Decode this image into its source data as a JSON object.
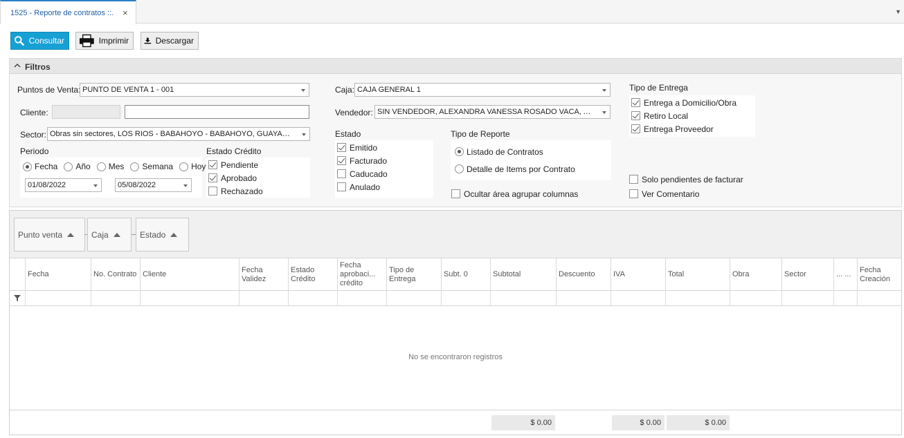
{
  "tab": {
    "title": "1525 - Reporte de contratos ::."
  },
  "toolbar": {
    "consultar": "Consultar",
    "imprimir": "Imprimir",
    "descargar": "Descargar"
  },
  "filtros": {
    "title": "Filtros",
    "puntos_venta_label": "Puntos de Venta:",
    "puntos_venta_value": "PUNTO DE VENTA 1 - 001",
    "cliente_label": "Cliente:",
    "sector_label": "Sector:",
    "sector_value": "Obras sin sectores, LOS RIOS - BABAHOYO - BABAHOYO, GUAYAS - DA...",
    "periodo_label": "Periodo",
    "periodo_options": [
      "Fecha",
      "Año",
      "Mes",
      "Semana",
      "Hoy"
    ],
    "fecha_desde": "01/08/2022",
    "fecha_hasta": "05/08/2022",
    "estado_credito_label": "Estado Crédito",
    "estado_credito_options": [
      "Pendiente",
      "Aprobado",
      "Rechazado"
    ],
    "caja_label": "Caja:",
    "caja_value": "CAJA GENERAL 1",
    "vendedor_label": "Vendedor:",
    "vendedor_value": "SIN VENDEDOR, ALEXANDRA VANESSA ROSADO VACA, ANGEL ...",
    "estado_label": "Estado",
    "estado_options": [
      "Emitido",
      "Facturado",
      "Caducado",
      "Anulado"
    ],
    "tipo_reporte_label": "Tipo de Reporte",
    "tipo_reporte_options": [
      "Listado de Contratos",
      "Detalle de Items por Contrato"
    ],
    "ocultar_label": "Ocultar área agrupar columnas",
    "tipo_entrega_label": "Tipo de Entrega",
    "tipo_entrega_options": [
      "Entrega a Domicilio/Obra",
      "Retiro Local",
      "Entrega Proveedor"
    ],
    "solo_pendientes_label": "Solo pendientes de facturar",
    "ver_comentario_label": "Ver Comentario"
  },
  "grid": {
    "group_columns": [
      "Punto venta",
      "Caja",
      "Estado"
    ],
    "columns": [
      "Fecha",
      "No. Contrato",
      "Cliente",
      "Fecha Validez",
      "Estado Crédito",
      "Fecha aprobaci... crédito",
      "Tipo de Entrega",
      "Subt. 0",
      "Subtotal",
      "Descuento",
      "IVA",
      "Total",
      "Obra",
      "Sector",
      "... ...",
      "Fecha Creación"
    ],
    "empty_text": "No se encontraron registros",
    "totals": {
      "subtotal": "$ 0.00",
      "iva": "$ 0.00",
      "total": "$ 0.00"
    }
  }
}
